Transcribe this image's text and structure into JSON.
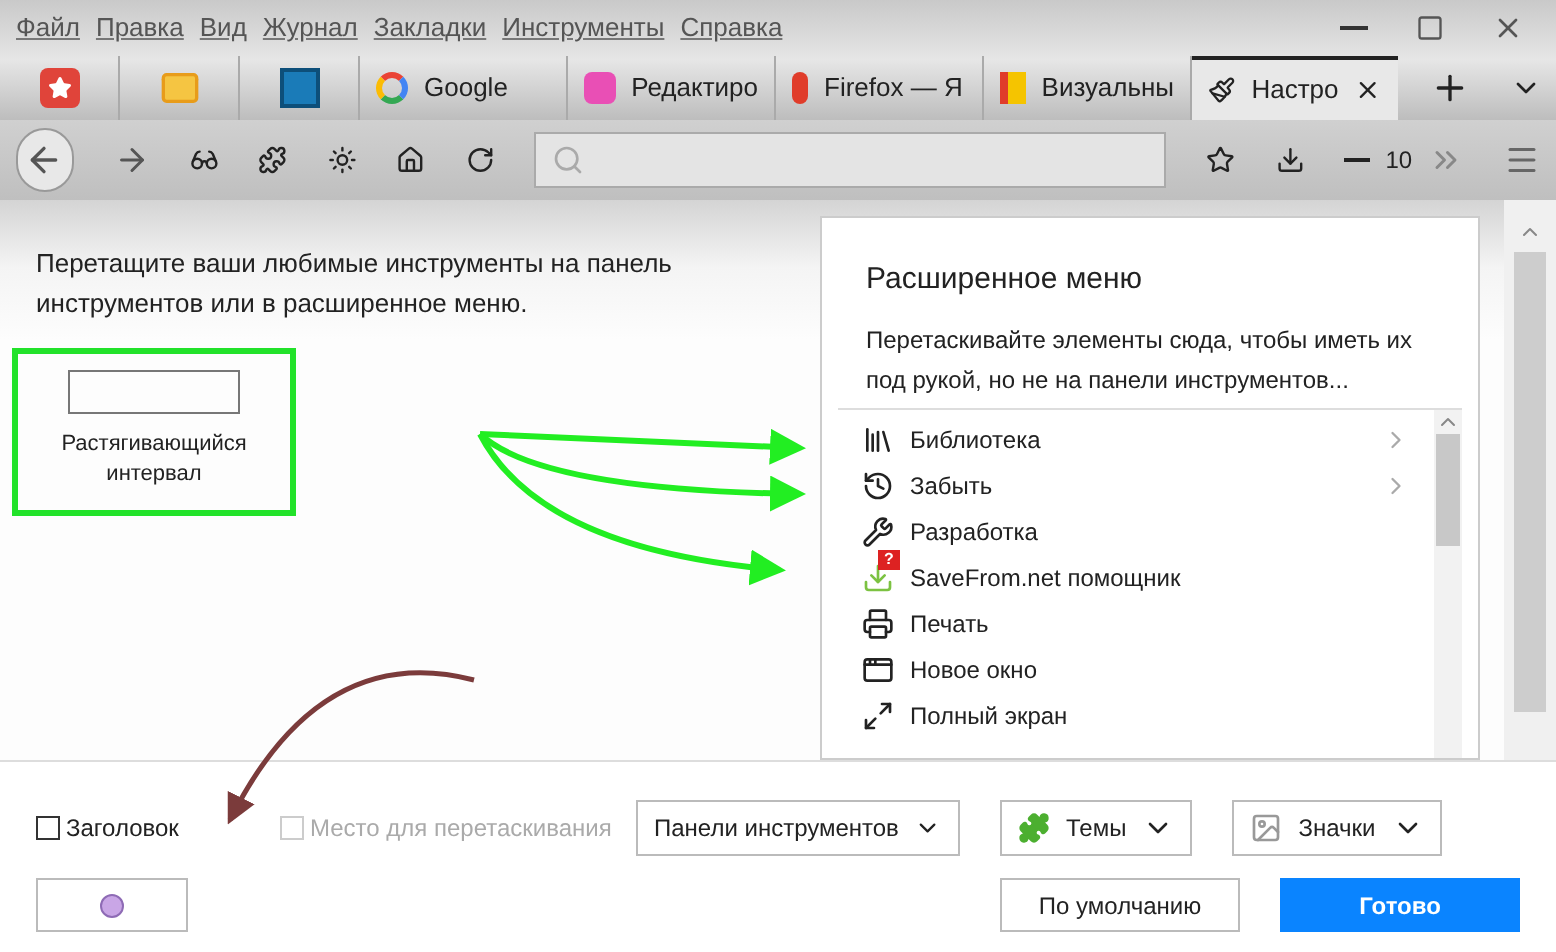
{
  "menu": [
    "Файл",
    "Правка",
    "Вид",
    "Журнал",
    "Закладки",
    "Инструменты",
    "Справка"
  ],
  "tabs": [
    {
      "kind": "pinned",
      "selected": false
    },
    {
      "kind": "pinned",
      "selected": false
    },
    {
      "kind": "pinned",
      "selected": false
    },
    {
      "kind": "page",
      "label": "Google",
      "selected": false
    },
    {
      "kind": "page",
      "label": "Редактиро",
      "selected": false
    },
    {
      "kind": "page",
      "label": "Firefox — Я",
      "selected": false
    },
    {
      "kind": "page",
      "label": "Визуальны",
      "selected": false
    },
    {
      "kind": "page",
      "label": "Настро",
      "selected": true
    }
  ],
  "zoom": "10",
  "intro": "Перетащите ваши любимые инструменты на панель инструментов или в расширенное меню.",
  "spacer": {
    "label": "Растягивающийся интервал"
  },
  "overflow_menu": {
    "title": "Расширенное меню",
    "description": "Перетаскивайте элементы сюда, чтобы иметь их под рукой, но не на панели инструментов...",
    "items": [
      {
        "label": "Библиотека",
        "submenu": true
      },
      {
        "label": "Забыть",
        "submenu": true
      },
      {
        "label": "Разработка",
        "submenu": false
      },
      {
        "label": "SaveFrom.net помощник",
        "submenu": false,
        "badge": "?"
      },
      {
        "label": "Печать",
        "submenu": false
      },
      {
        "label": "Новое окно",
        "submenu": false
      },
      {
        "label": "Полный экран",
        "submenu": false
      }
    ]
  },
  "checkboxes": [
    {
      "label": "Заголовок",
      "checked": false,
      "disabled": false
    },
    {
      "label": "Место для перетаскивания",
      "checked": false,
      "disabled": true
    }
  ],
  "dropdowns": [
    "Панели инструментов",
    "Темы",
    "Значки"
  ],
  "buttons": [
    {
      "label": "По умолчанию",
      "kind": "secondary"
    },
    {
      "label": "Готово",
      "kind": "primary"
    }
  ]
}
